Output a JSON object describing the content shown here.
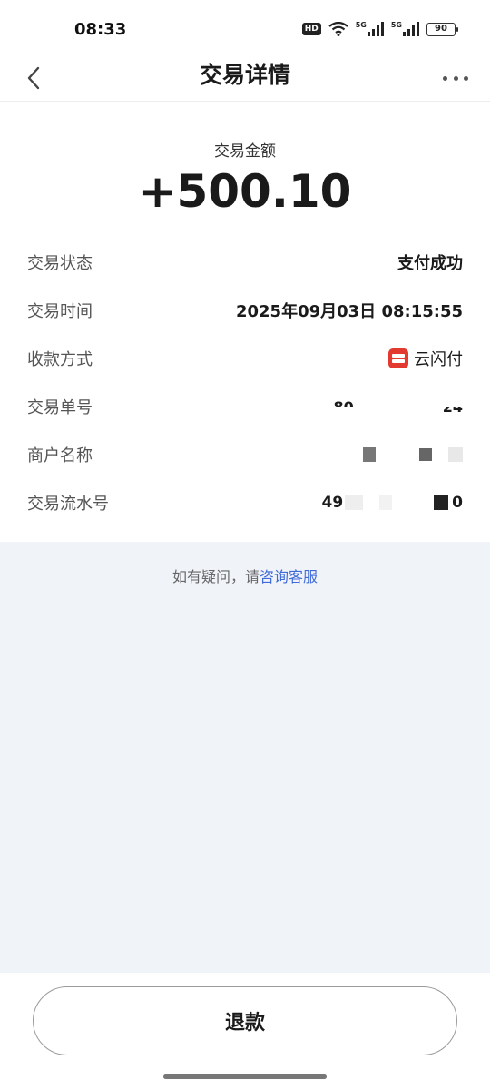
{
  "status_bar": {
    "time": "08:33",
    "hd_label": "HD",
    "network_1": "5G",
    "network_2": "5G",
    "battery": "90",
    "icons": [
      "hd-icon",
      "wifi-icon",
      "signal-icon",
      "signal-icon",
      "battery-icon"
    ]
  },
  "header": {
    "title": "交易详情",
    "back_icon": "chevron-left-icon",
    "more_icon": "more-dots-icon"
  },
  "amount": {
    "label": "交易金额",
    "value": "+500.10"
  },
  "details": [
    {
      "label": "交易状态",
      "value": "支付成功"
    },
    {
      "label": "交易时间",
      "value": "2025年09月03日 08:15:55"
    },
    {
      "label": "收款方式",
      "value": "云闪付",
      "icon": "unionpay-quickpass-icon"
    },
    {
      "label": "交易单号",
      "value_visible_prefix": "80",
      "value_visible_suffix": "24"
    },
    {
      "label": "商户名称"
    },
    {
      "label": "交易流水号",
      "value_visible_prefix": "49",
      "value_visible_suffix": "0"
    }
  ],
  "note": {
    "text": "如有疑问，请",
    "link": "咨询客服"
  },
  "actions": {
    "refund_label": "退款"
  },
  "colors": {
    "link": "#3f6ad8",
    "background": "#f0f3f8",
    "brand_red": "#e23a2e"
  }
}
